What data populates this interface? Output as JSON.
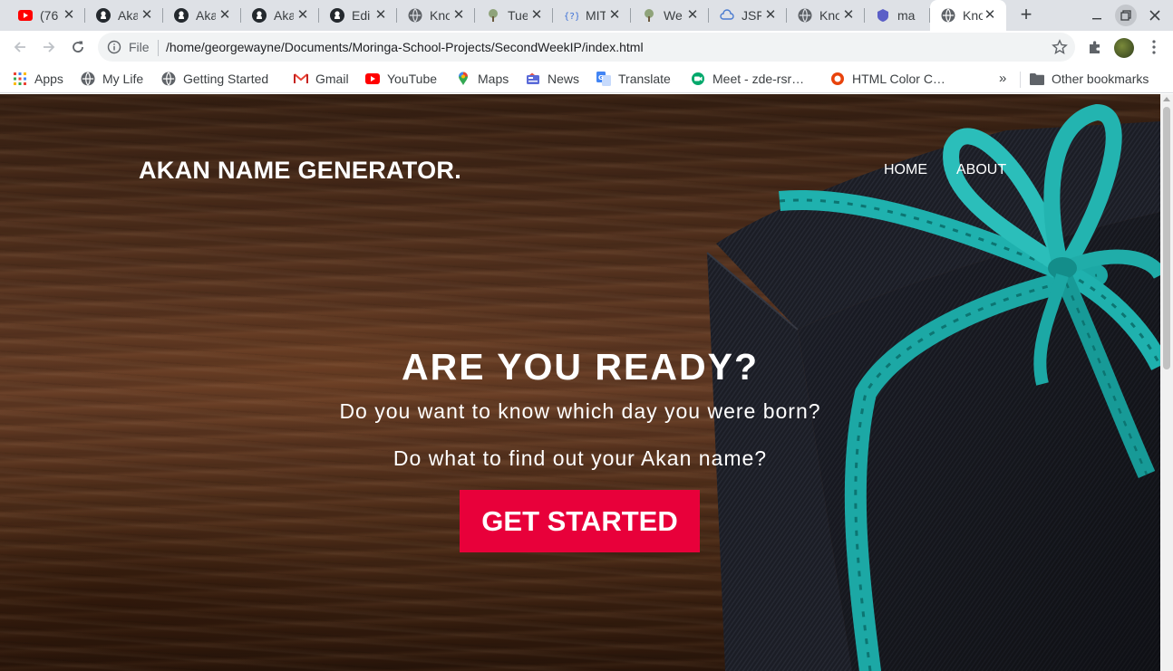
{
  "browser": {
    "tabs": [
      {
        "title": "(76",
        "icon": "youtube-icon"
      },
      {
        "title": "Aka",
        "icon": "github-icon"
      },
      {
        "title": "Aka",
        "icon": "github-icon"
      },
      {
        "title": "Aka",
        "icon": "github-icon"
      },
      {
        "title": "Edi",
        "icon": "github-icon"
      },
      {
        "title": "Kno",
        "icon": "globe-icon"
      },
      {
        "title": "Tue",
        "icon": "tree-icon"
      },
      {
        "title": "MIT",
        "icon": "code-icon"
      },
      {
        "title": "We",
        "icon": "tree-icon"
      },
      {
        "title": "JSF",
        "icon": "cloud-icon"
      },
      {
        "title": "Kno",
        "icon": "globe-icon"
      },
      {
        "title": "ma",
        "icon": "shield-icon"
      },
      {
        "title": "Kno",
        "icon": "globe-icon",
        "active": true
      }
    ],
    "new_tab_label": "+",
    "close_glyph": "✕"
  },
  "toolbar": {
    "scheme_label": "File",
    "url": "/home/georgewayne/Documents/Moringa-School-Projects/SecondWeekIP/index.html"
  },
  "bookmarks": {
    "items": [
      {
        "label": "Apps",
        "icon": "apps-grid-icon"
      },
      {
        "label": "My Life",
        "icon": "globe-icon"
      },
      {
        "label": "Getting Started",
        "icon": "globe-icon"
      },
      {
        "label": "Gmail",
        "icon": "gmail-icon"
      },
      {
        "label": "YouTube",
        "icon": "youtube-icon"
      },
      {
        "label": "Maps",
        "icon": "maps-pin-icon"
      },
      {
        "label": "News",
        "icon": "news-icon"
      },
      {
        "label": "Translate",
        "icon": "translate-icon"
      },
      {
        "label": "Meet - zde-rsr…",
        "icon": "meet-icon"
      },
      {
        "label": "HTML Color C…",
        "icon": "color-icon"
      }
    ],
    "more_label": "»",
    "other_label": "Other bookmarks"
  },
  "page": {
    "brand": "AKAN NAME GENERATOR.",
    "nav": {
      "home": "HOME",
      "about": "ABOUT"
    },
    "hero": {
      "title": "ARE YOU READY?",
      "subtitle_1": "Do you want to know which day you were born?",
      "subtitle_2": "Do what to find out your Akan name?",
      "cta": "GET STARTED"
    }
  },
  "colors": {
    "cta": "#e8003a",
    "ribbon": "#1fb7b3",
    "gift_box": "#1c1d24",
    "wood": "#5a3520"
  }
}
